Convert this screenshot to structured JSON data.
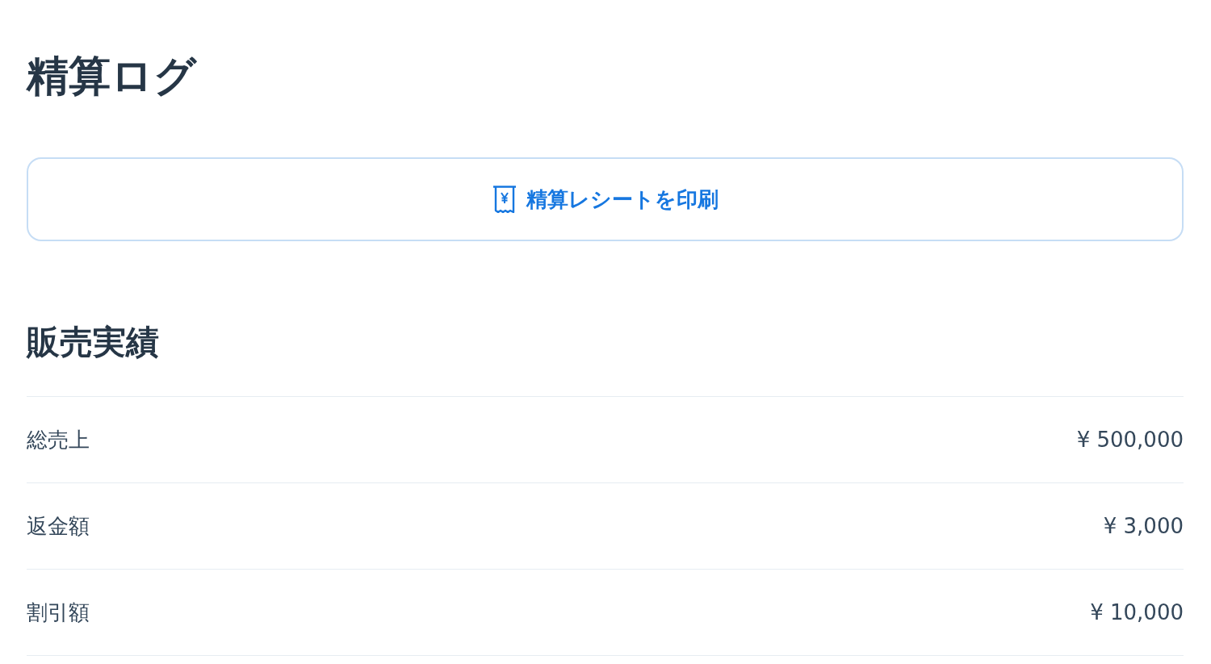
{
  "page": {
    "title": "精算ログ"
  },
  "print_button": {
    "label": "精算レシートを印刷"
  },
  "sales_summary": {
    "heading": "販売実績",
    "rows": [
      {
        "label": "総売上",
        "value": "¥ 500,000"
      },
      {
        "label": "返金額",
        "value": "¥ 3,000"
      },
      {
        "label": "割引額",
        "value": "¥ 10,000"
      }
    ]
  }
}
